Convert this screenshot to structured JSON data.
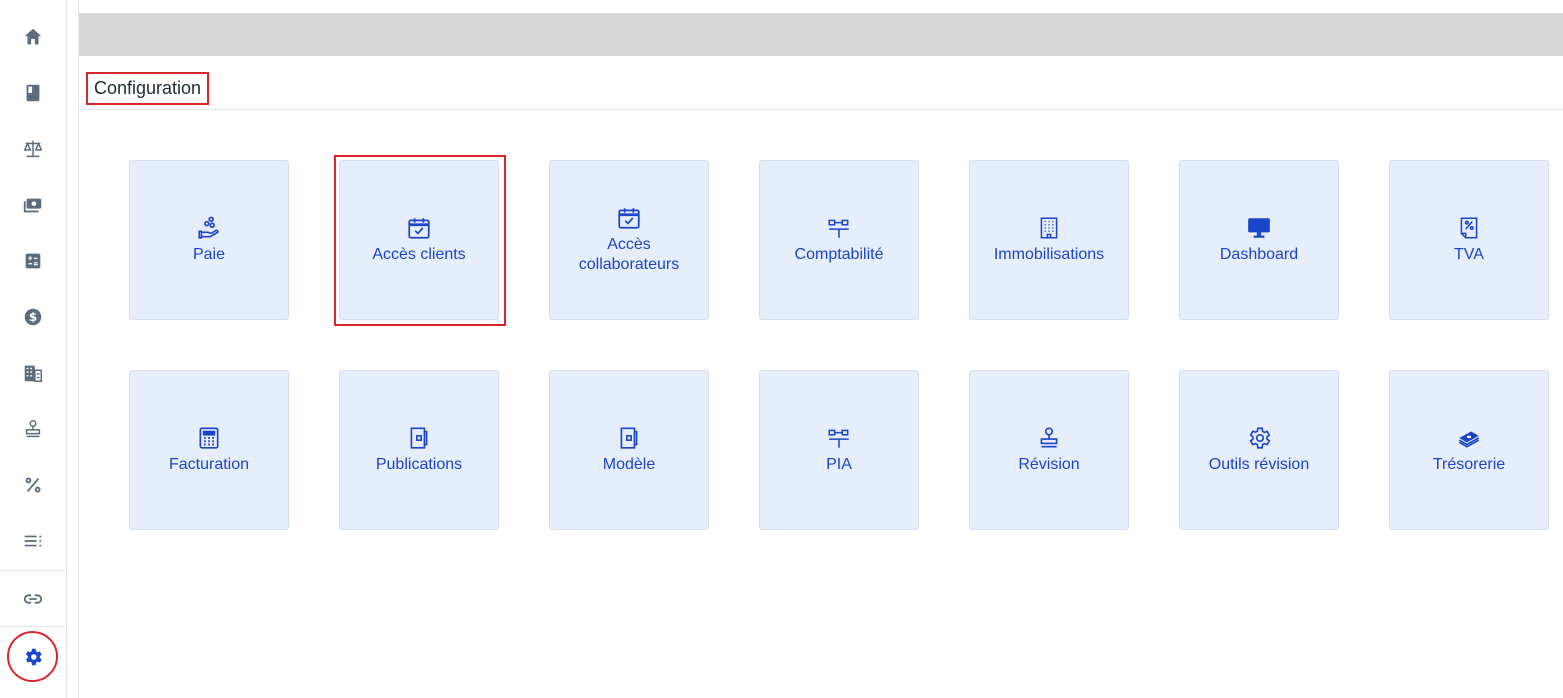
{
  "sidebar": {
    "items": [
      {
        "icon": "home-icon"
      },
      {
        "icon": "book-icon"
      },
      {
        "icon": "scale-icon"
      },
      {
        "icon": "money-icon"
      },
      {
        "icon": "calculator-icon"
      },
      {
        "icon": "dollar-icon"
      },
      {
        "icon": "building-icon"
      },
      {
        "icon": "stamp-icon"
      },
      {
        "icon": "percent-icon"
      },
      {
        "icon": "list-icon"
      },
      {
        "icon": "link-icon"
      },
      {
        "icon": "gear-icon",
        "active": true
      }
    ],
    "accent": "#1a44c9",
    "icon_color": "#5b6b80"
  },
  "header": {
    "title": "Configuration"
  },
  "tiles_row1": [
    {
      "label": "Paie",
      "icon": "hand-coins-icon"
    },
    {
      "label": "Accès clients",
      "icon": "calendar-check-icon"
    },
    {
      "label": "Accès collaborateurs",
      "icon": "calendar-check-icon"
    },
    {
      "label": "Comptabilité",
      "icon": "sitemap-icon"
    },
    {
      "label": "Immobilisations",
      "icon": "building-icon"
    },
    {
      "label": "Dashboard",
      "icon": "monitor-icon"
    },
    {
      "label": "TVA",
      "icon": "percent-doc-icon"
    }
  ],
  "tiles_row2": [
    {
      "label": "Facturation",
      "icon": "calculator-icon"
    },
    {
      "label": "Publications",
      "icon": "wallet-icon"
    },
    {
      "label": "Modèle",
      "icon": "wallet-icon"
    },
    {
      "label": "PIA",
      "icon": "sitemap-icon"
    },
    {
      "label": "Révision",
      "icon": "stamp-icon"
    },
    {
      "label": "Outils révision",
      "icon": "gear-icon"
    },
    {
      "label": "Trésorerie",
      "icon": "money-stack-icon"
    }
  ],
  "colors": {
    "tile_bg": "#e6edfb",
    "tile_text": "#1a44c9",
    "highlight": "#d9262c"
  }
}
